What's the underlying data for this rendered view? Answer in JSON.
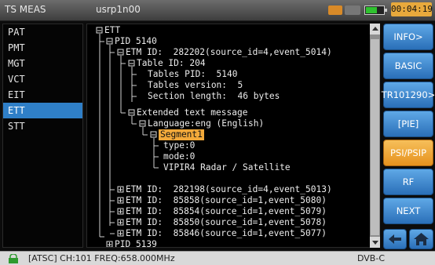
{
  "header": {
    "app_title": "TS MEAS",
    "device_name": "usrp1n00",
    "clock": "00:04:19"
  },
  "left_list": {
    "items": [
      "PAT",
      "PMT",
      "MGT",
      "VCT",
      "EIT",
      "ETT",
      "STT"
    ],
    "selected": "ETT"
  },
  "tree": {
    "rows": [
      "ETT",
      "PID 5140",
      "ETM ID:  282202(source_id=4,event_5014)",
      "Table ID: 204",
      "Tables PID:  5140",
      "Tables version:  5",
      "Section length:  46 bytes",
      "Extended text message",
      "Language:eng (English)",
      "Segment1",
      "type:0",
      "mode:0",
      "VIPIR4 Radar / Satellite",
      "ETM ID:  282198(source_id=4,event_5013)",
      "ETM ID:  85858(source_id=1,event_5080)",
      "ETM ID:  85854(source_id=1,event_5079)",
      "ETM ID:  85850(source_id=1,event_5078)",
      "ETM ID:  85846(source_id=1,event_5077)",
      "PID 5139"
    ],
    "highlighted": "Segment1"
  },
  "buttons": {
    "info": "INFO>",
    "basic": "BASIC",
    "tr101290": "TR101290>",
    "pie": "[PIE]",
    "psi_psip": "PSI/PSIP",
    "rf": "RF",
    "next": "NEXT"
  },
  "status": {
    "text": "[ATSC] CH:101  FREQ:658.000MHz",
    "mode": "DVB-C"
  },
  "colors": {
    "accent": "#2f7fc8",
    "highlight": "#f2a93a",
    "active_button": "#e6921e"
  }
}
